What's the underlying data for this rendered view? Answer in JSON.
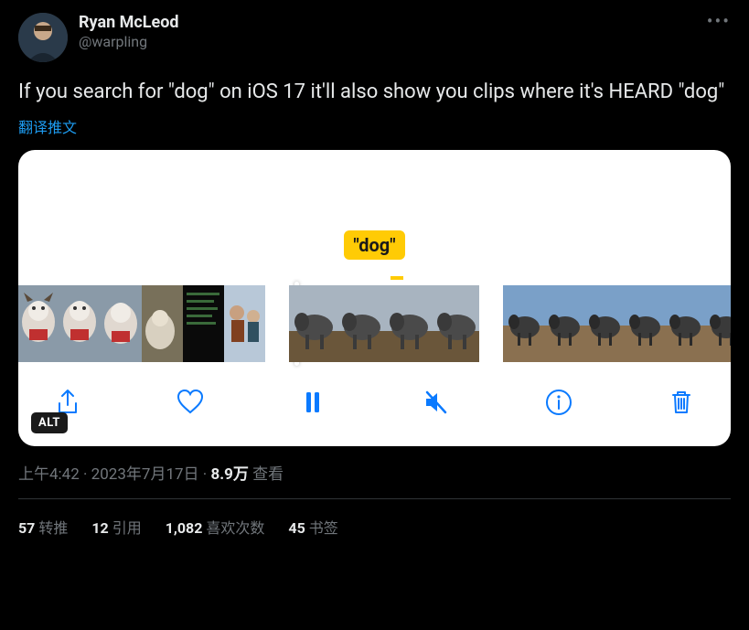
{
  "author": {
    "display_name": "Ryan McLeod",
    "handle": "@warpling"
  },
  "tweet_text": "If you search for \"dog\" on iOS 17 it'll also show you clips where it's HEARD \"dog\"",
  "translate_label": "翻译推文",
  "media": {
    "search_tag": "\"dog\"",
    "alt_badge": "ALT",
    "toolbar": {
      "share": "share-icon",
      "like": "heart-icon",
      "pause": "pause-icon",
      "mute": "mute-icon",
      "info": "info-icon",
      "trash": "trash-icon"
    }
  },
  "meta": {
    "time": "上午4:42",
    "date": "2023年7月17日",
    "views_count": "8.9万",
    "views_label": "查看"
  },
  "stats": {
    "retweets_count": "57",
    "retweets_label": "转推",
    "quotes_count": "12",
    "quotes_label": "引用",
    "likes_count": "1,082",
    "likes_label": "喜欢次数",
    "bookmarks_count": "45",
    "bookmarks_label": "书签"
  }
}
